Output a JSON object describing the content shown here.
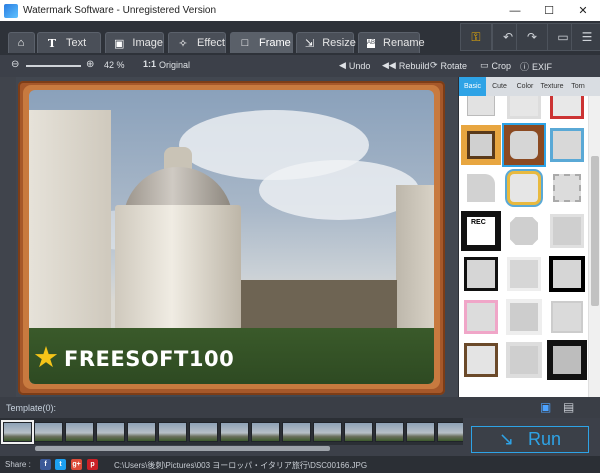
{
  "window": {
    "title": "Watermark Software - Unregistered Version",
    "controls": [
      "—",
      "☐",
      "✕"
    ]
  },
  "tabs": [
    {
      "id": "home",
      "label": "",
      "icon": "home-icon",
      "glyph": "⌂"
    },
    {
      "id": "text",
      "label": "Text",
      "icon": "text-icon",
      "glyph": "T"
    },
    {
      "id": "image",
      "label": "Image",
      "icon": "image-icon",
      "glyph": "▣"
    },
    {
      "id": "effect",
      "label": "Effect",
      "icon": "wand-icon",
      "glyph": "✧"
    },
    {
      "id": "frame",
      "label": "Frame",
      "icon": "frame-icon",
      "glyph": "□",
      "active": true
    },
    {
      "id": "resize",
      "label": "Resize",
      "icon": "resize-icon",
      "glyph": "⇲"
    },
    {
      "id": "rename",
      "label": "Rename",
      "icon": "rename-icon",
      "glyph": "AB"
    }
  ],
  "right_buttons": [
    {
      "id": "key",
      "glyph": "⚿",
      "icon": "key-icon"
    },
    {
      "id": "undo",
      "glyph": "↶",
      "icon": "undo-icon"
    },
    {
      "id": "redo",
      "glyph": "↷",
      "icon": "redo-icon"
    },
    {
      "id": "chat",
      "glyph": "▭",
      "icon": "chat-icon"
    },
    {
      "id": "menu",
      "glyph": "☰",
      "icon": "menu-icon"
    }
  ],
  "toolbar": {
    "zoom_minus": "⊖",
    "zoom_plus": "⊕",
    "zoom_value": "42 %",
    "original_icon": "1:1",
    "original_label": "Original",
    "undo": "Undo",
    "rebuild": "Rebuild",
    "rotate": "Rotate",
    "crop": "Crop",
    "exif": "EXIF"
  },
  "watermark": {
    "text": "FREESOFT100",
    "star": "★"
  },
  "frame_tabs": [
    {
      "id": "basic",
      "label": "Basic",
      "active": true
    },
    {
      "id": "cute",
      "label": "Cute"
    },
    {
      "id": "color",
      "label": "Color"
    },
    {
      "id": "texture",
      "label": "Texture"
    },
    {
      "id": "torn",
      "label": "Torn"
    }
  ],
  "frame_rec_label": "REC",
  "template": {
    "label": "Template(0):"
  },
  "run": {
    "label": "Run",
    "icon": "↘"
  },
  "status": {
    "share_label": "Share :",
    "social": [
      "f",
      "t",
      "g+",
      "p"
    ],
    "path": "C:\\Users\\後刺\\Pictures\\003 ヨーロッパ・イタリア旅行\\DSC00166.JPG"
  }
}
